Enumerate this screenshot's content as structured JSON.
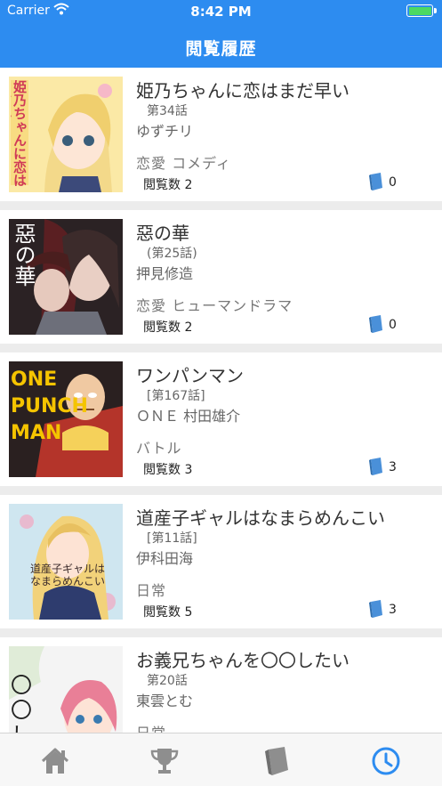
{
  "status_bar": {
    "carrier": "Carrier",
    "time": "8:42 PM"
  },
  "header": {
    "title": "閲覧履歴"
  },
  "items": [
    {
      "title": "姫乃ちゃんに恋はまだ早い",
      "episode": "第34話",
      "author": "ゆずチリ",
      "genre": "恋愛 コメディ",
      "views": "閲覧数 2",
      "count": "0",
      "cover": {
        "text": "姫乃ちゃんに恋はまだ早い",
        "bg": "#fbe9a6",
        "accent": "#e8c55a"
      }
    },
    {
      "title": "惡の華",
      "episode": "(第25話)",
      "author": "押見修造",
      "genre": "恋愛 ヒューマンドラマ",
      "views": "閲覧数 2",
      "count": "0",
      "cover": {
        "text": "惡の華",
        "bg": "#2b2224",
        "accent": "#8b2a2a"
      }
    },
    {
      "title": "ワンパンマン",
      "episode": "[第167話]",
      "author": "ＯＮＥ 村田雄介",
      "genre": "バトル",
      "views": "閲覧数 3",
      "count": "3",
      "cover": {
        "text": "ONE PUNCH MAN",
        "bg": "#1a1a1a",
        "accent": "#f5c400"
      }
    },
    {
      "title": "道産子ギャルはなまらめんこい",
      "episode": "[第11話]",
      "author": "伊科田海",
      "genre": "日常",
      "views": "閲覧数 5",
      "count": "3",
      "cover": {
        "text": "道産子ギャルはなまらめんこい",
        "bg": "#cfe6f0",
        "accent": "#f2d27a"
      }
    },
    {
      "title": "お義兄ちゃんを〇〇したい",
      "episode": "第20話",
      "author": "東雲とむ",
      "genre": "日常",
      "views": "",
      "count": "",
      "cover": {
        "text": "〇〇したい",
        "bg": "#f4f4f4",
        "accent": "#e97f97"
      }
    }
  ],
  "icons": {
    "count": "book-icon"
  },
  "tabs": [
    {
      "name": "home-icon",
      "active": false
    },
    {
      "name": "trophy-icon",
      "active": false
    },
    {
      "name": "book-icon",
      "active": false
    },
    {
      "name": "clock-icon",
      "active": true
    }
  ],
  "colors": {
    "accent": "#2d8cf0",
    "inactive": "#8e8e8e",
    "book": "#4a90d9"
  }
}
